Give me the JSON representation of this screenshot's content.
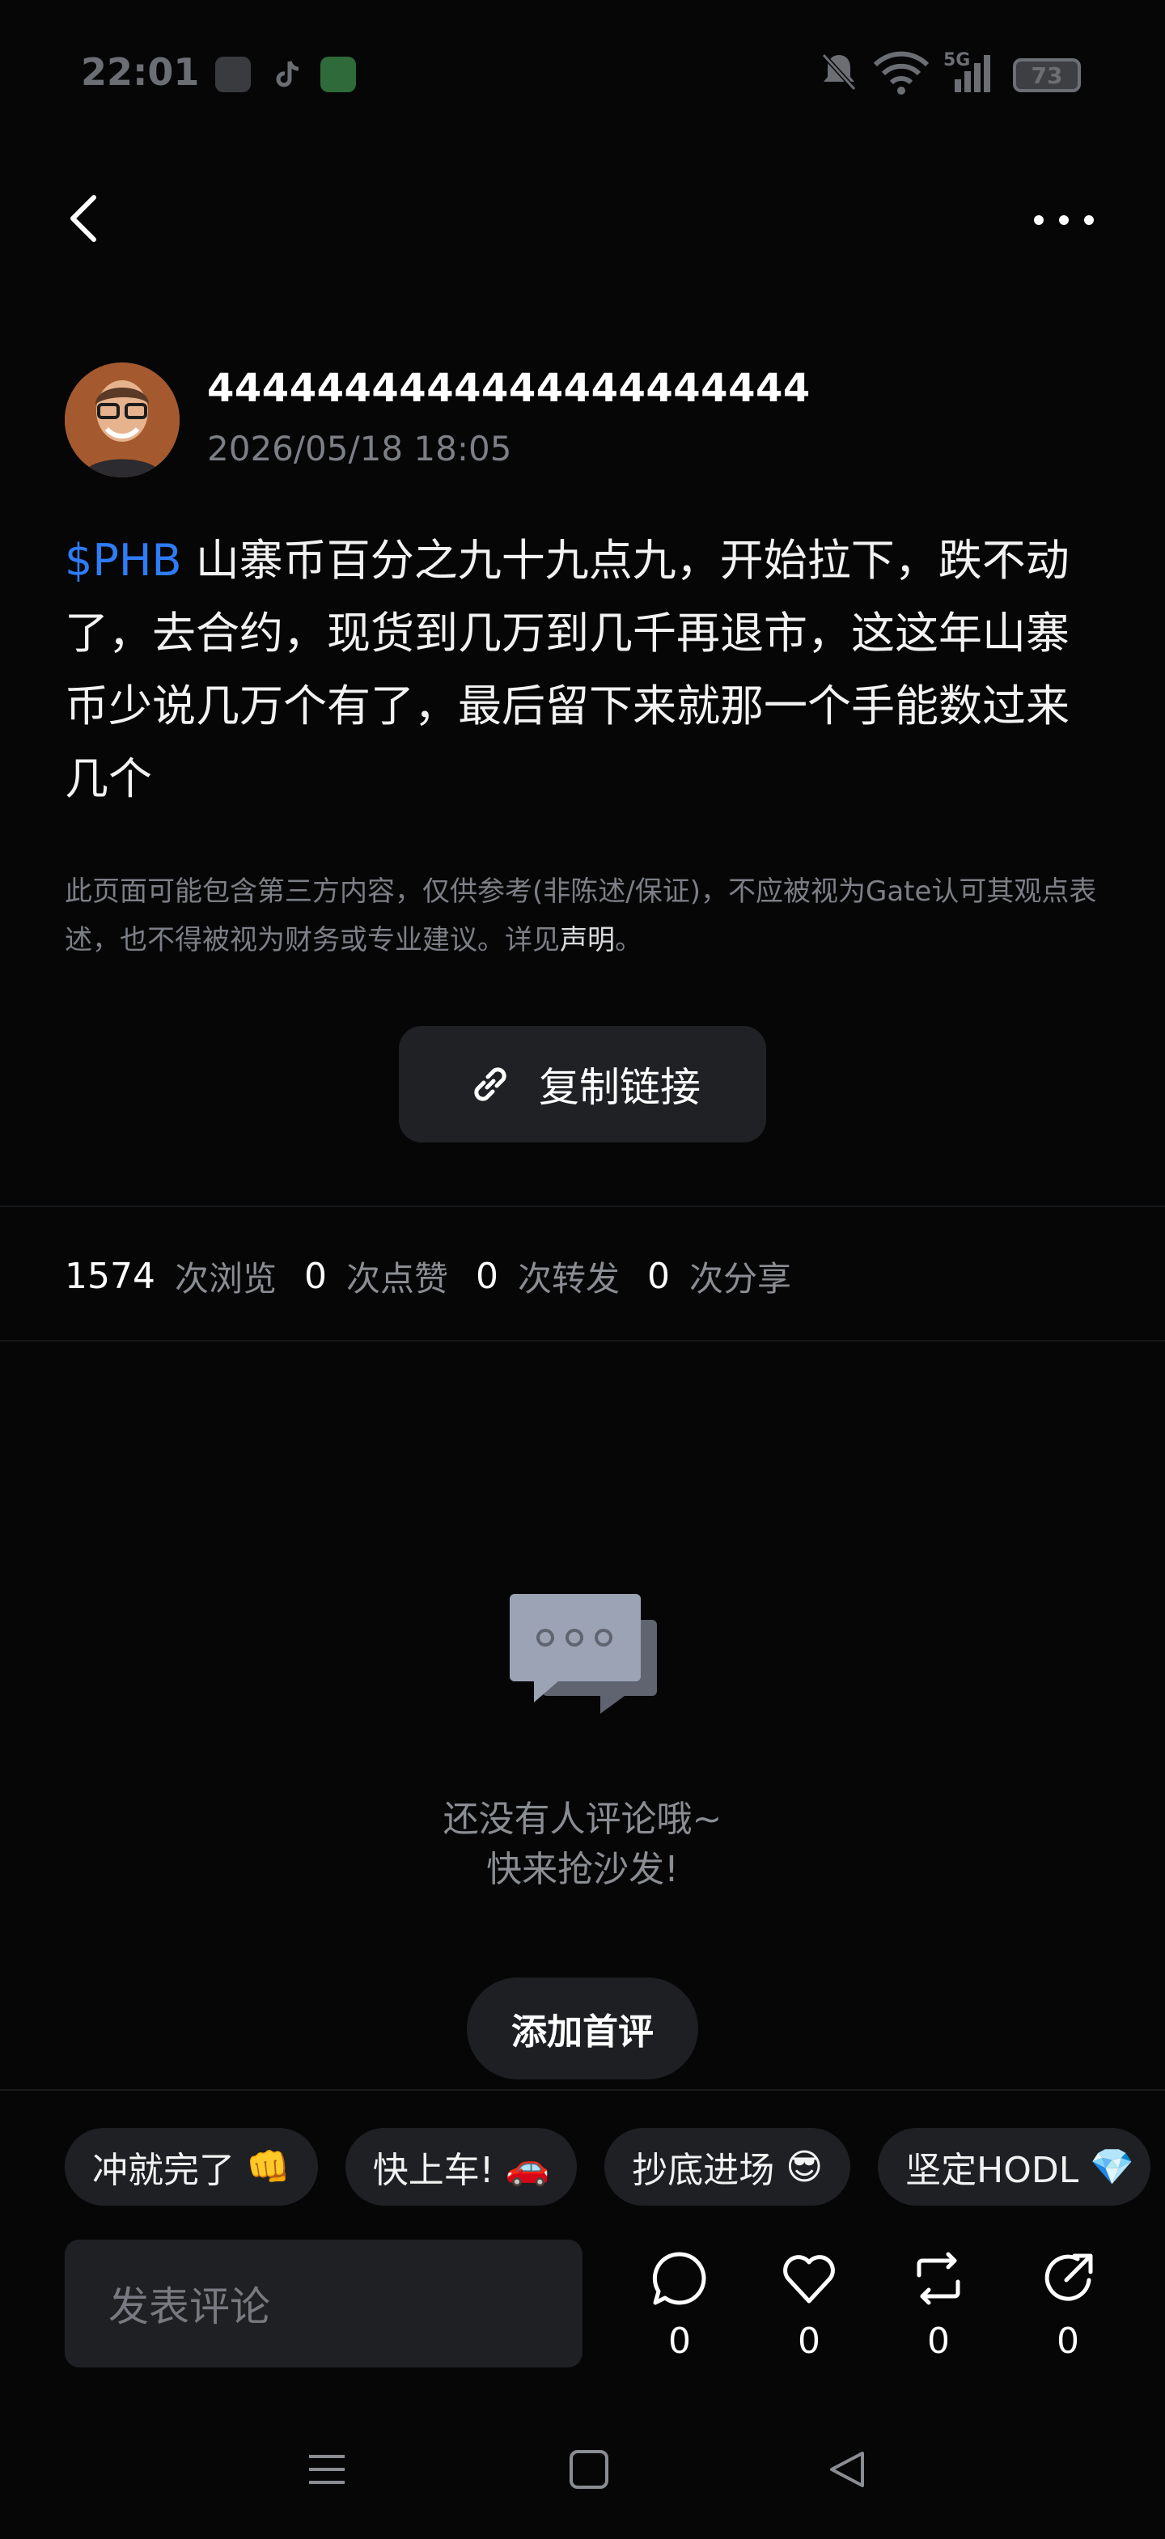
{
  "status_bar": {
    "time": "22:01",
    "battery": "73",
    "network": "5G"
  },
  "post": {
    "author_name": "4444444444444444444444",
    "date": "2026/05/18 18:05",
    "ticker": "$PHB",
    "content": " 山寨币百分之九十九点九，开始拉下，跌不动了，去合约，现货到几万到几千再退市，这这年山寨币少说几万个有了，最后留下来就那一个手能数过来几个",
    "disclaimer_text": "此页面可能包含第三方内容，仅供参考(非陈述/保证)，不应被视为Gate认可其观点表述，也不得被视为财务或专业建议。详见",
    "disclaimer_link": "声明",
    "disclaimer_end": "。"
  },
  "copy_link_label": "复制链接",
  "stats": [
    {
      "value": "1574",
      "label": "次浏览"
    },
    {
      "value": "0",
      "label": "次点赞"
    },
    {
      "value": "0",
      "label": "次转发"
    },
    {
      "value": "0",
      "label": "次分享"
    }
  ],
  "comments": {
    "empty_line1": "还没有人评论哦~",
    "empty_line2": "快来抢沙发!",
    "add_first_label": "添加首评"
  },
  "quick_replies": [
    {
      "text": "冲就完了",
      "emoji": "👊"
    },
    {
      "text": "快上车!",
      "emoji": "🚗"
    },
    {
      "text": "抄底进场",
      "emoji": "😎"
    },
    {
      "text": "坚定HODL",
      "emoji": "💎"
    }
  ],
  "comment_input_placeholder": "发表评论",
  "actions": {
    "comment_count": "0",
    "like_count": "0",
    "repost_count": "0",
    "share_count": "0"
  }
}
